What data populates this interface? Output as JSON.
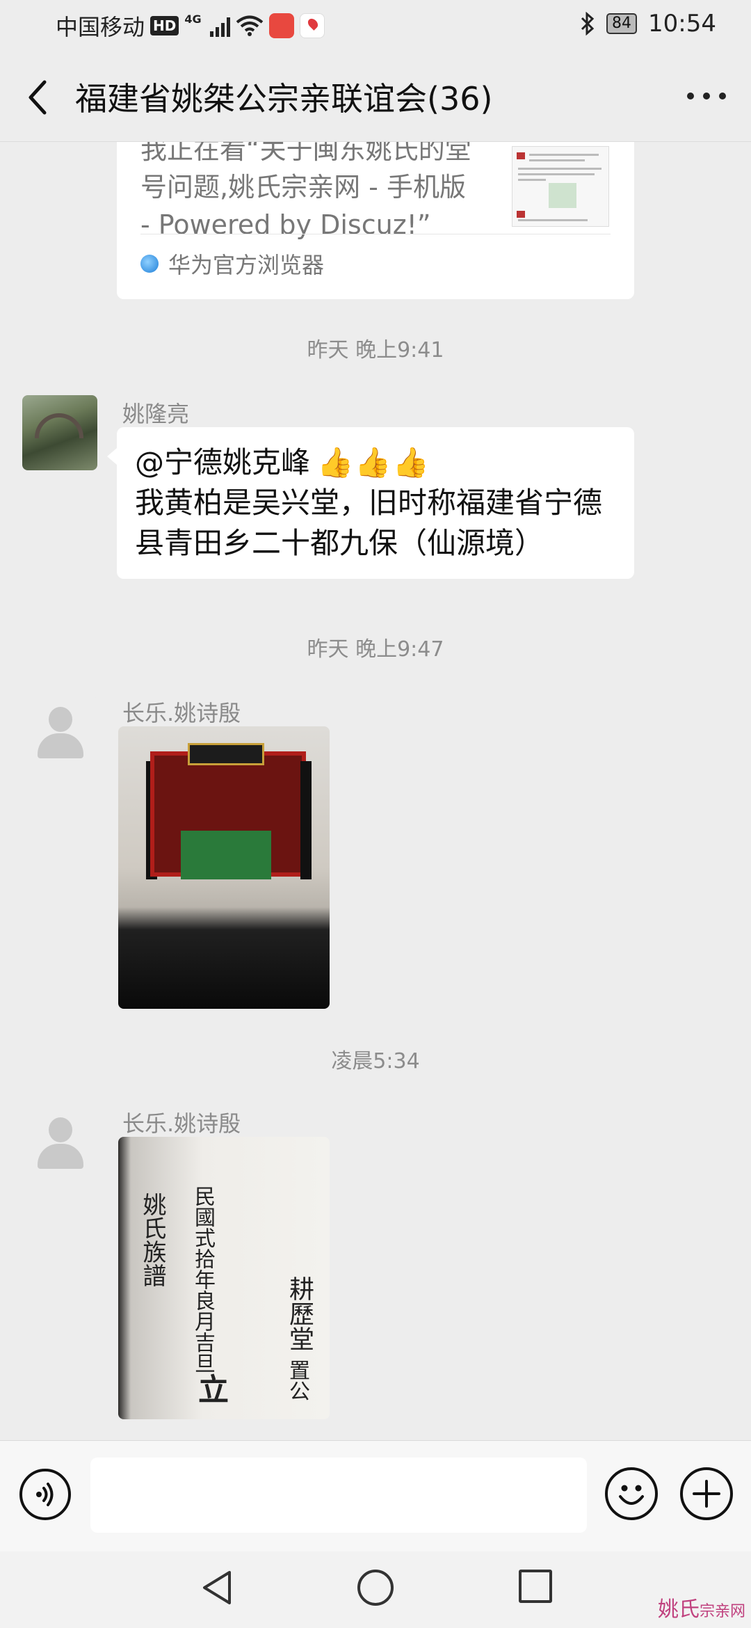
{
  "status_bar": {
    "carrier": "中国移动",
    "hd": "HD",
    "network": "4G",
    "battery": "84",
    "time": "10:54"
  },
  "header": {
    "title": "福建省姚桀公宗亲联谊会(36)"
  },
  "messages": {
    "link_card": {
      "text": "我正在看“关于闽东姚氏的堂号问题,姚氏宗亲网 - 手机版 - Powered by Discuz!”",
      "source": "华为官方浏览器"
    },
    "ts1": "昨天 晚上9:41",
    "msg1": {
      "sender": "姚隆亮",
      "line1": "@宁德姚克峰",
      "thumbs": "👍👍👍",
      "line2": "我黄柏是吴兴堂，旧时称福建省宁德县青田乡二十都九保（仙源境）"
    },
    "ts2": "昨天 晚上9:47",
    "msg2": {
      "sender": "长乐.姚诗殷"
    },
    "ts3": "凌晨5:34",
    "msg3": {
      "sender": "长乐.姚诗殷",
      "photo_text": {
        "col1": "姚氏族譜",
        "col2": "民國式拾年良月吉旦",
        "col2_big": "立",
        "col3": "耕歷堂",
        "col3_tail": "置公"
      }
    }
  },
  "input_bar": {
    "placeholder": ""
  },
  "watermark": {
    "main": "姚氏",
    "sub": "宗亲网"
  }
}
